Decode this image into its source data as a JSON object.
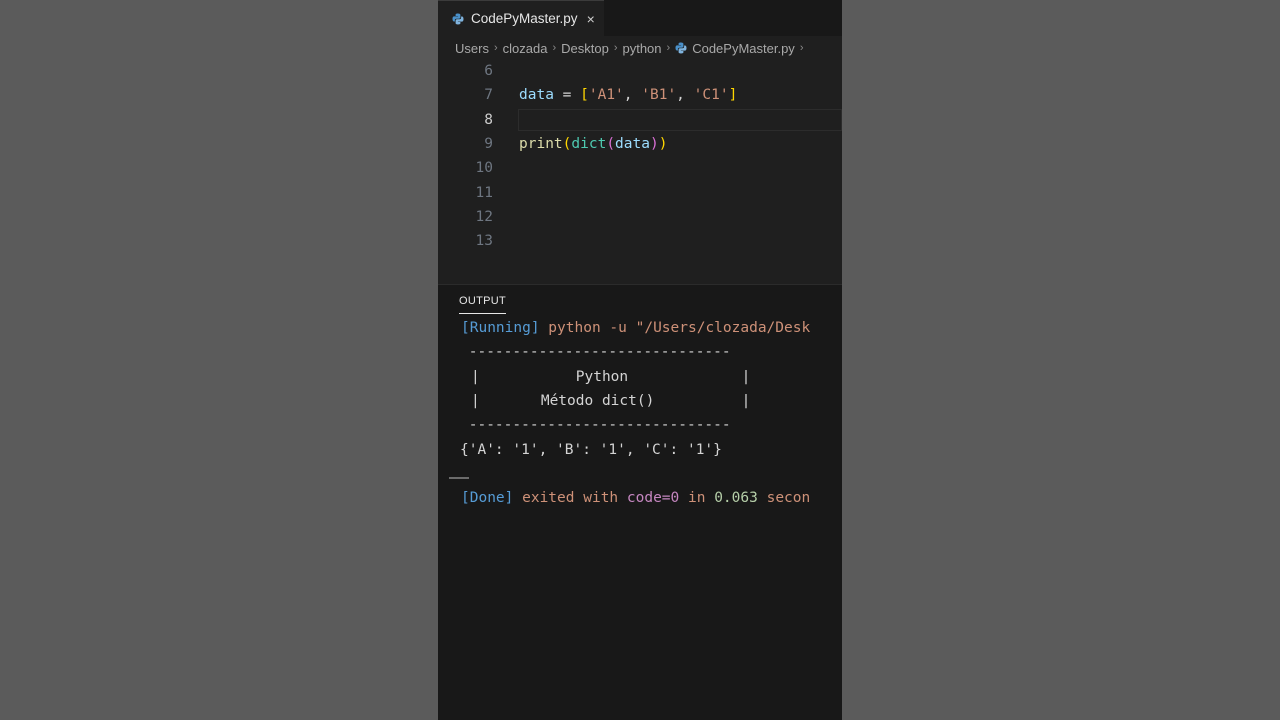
{
  "tab": {
    "filename": "CodePyMaster.py",
    "close_icon": "×"
  },
  "breadcrumb": [
    "Users",
    "clozada",
    "Desktop",
    "python",
    "CodePyMaster.py"
  ],
  "editor": {
    "active_line": "8",
    "lines": [
      {
        "num": "6",
        "tokens": []
      },
      {
        "num": "7",
        "tokens": [
          {
            "text": "data",
            "class": "t-var"
          },
          {
            "text": " = ",
            "class": "t-op"
          },
          {
            "text": "[",
            "class": "t-br1"
          },
          {
            "text": "'A1'",
            "class": "t-str"
          },
          {
            "text": ", ",
            "class": "t-op"
          },
          {
            "text": "'B1'",
            "class": "t-str"
          },
          {
            "text": ", ",
            "class": "t-op"
          },
          {
            "text": "'C1'",
            "class": "t-str"
          },
          {
            "text": "]",
            "class": "t-br1"
          }
        ]
      },
      {
        "num": "8",
        "tokens": []
      },
      {
        "num": "9",
        "tokens": [
          {
            "text": "print",
            "class": "t-fn"
          },
          {
            "text": "(",
            "class": "t-br1"
          },
          {
            "text": "dict",
            "class": "t-builtin"
          },
          {
            "text": "(",
            "class": "t-br2"
          },
          {
            "text": "data",
            "class": "t-var"
          },
          {
            "text": ")",
            "class": "t-br2"
          },
          {
            "text": ")",
            "class": "t-br1"
          }
        ]
      },
      {
        "num": "10",
        "tokens": []
      },
      {
        "num": "11",
        "tokens": []
      },
      {
        "num": "12",
        "tokens": []
      },
      {
        "num": "13",
        "tokens": []
      }
    ]
  },
  "panel": {
    "tab_label": "OUTPUT",
    "running_tag": "[Running]",
    "running_cmd": " python -u \"/Users/clozada/Desk",
    "box_top": " ------------------------------",
    "box_line1": "|           Python             |",
    "box_line2": "|       Método dict()          |",
    "box_bottom": " ------------------------------",
    "result": "{'A': '1', 'B': '1', 'C': '1'}",
    "done_tag": "[Done]",
    "done_text": " exited with ",
    "done_code": "code=0",
    "done_in": " in ",
    "done_time": "0.063",
    "done_unit": " secon"
  }
}
